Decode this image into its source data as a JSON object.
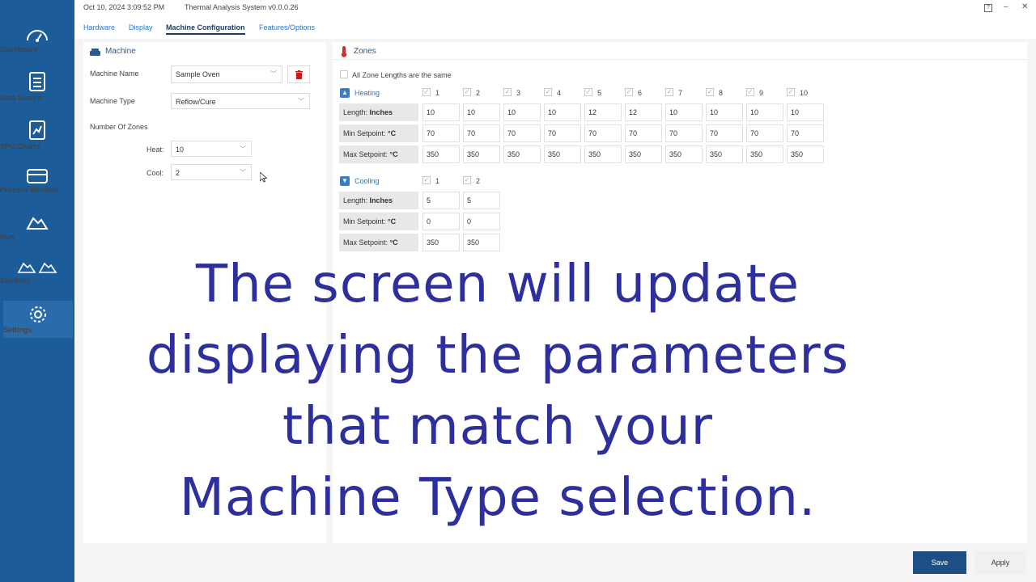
{
  "titlebar": {
    "datetime": "Oct 10, 2024 3:09:52 PM",
    "app_title": "Thermal Analysis System v0.0.0.26",
    "help": "?",
    "minimize": "–",
    "close": "✕"
  },
  "sidebar": {
    "items": [
      {
        "label": "Dashboard",
        "icon": "gauge-icon"
      },
      {
        "label": "Data Search",
        "icon": "document-icon"
      },
      {
        "label": "SPC Charts",
        "icon": "spc-chart-icon"
      },
      {
        "label": "Process Window",
        "icon": "window-icon"
      },
      {
        "label": "Run",
        "icon": "profile-icon"
      },
      {
        "label": "Stacking",
        "icon": "stacking-icon"
      },
      {
        "label": "Settings",
        "icon": "gear-icon"
      }
    ]
  },
  "tabs": [
    {
      "label": "Hardware"
    },
    {
      "label": "Display"
    },
    {
      "label": "Machine Configuration"
    },
    {
      "label": "Features/Options"
    }
  ],
  "machine": {
    "title": "Machine",
    "name_label": "Machine Name",
    "name_value": "Sample Oven",
    "type_label": "Machine Type",
    "type_value": "Reflow/Cure",
    "zones_label": "Number Of Zones",
    "heat_label": "Heat:",
    "heat_value": "10",
    "cool_label": "Cool:",
    "cool_value": "2"
  },
  "zones": {
    "title": "Zones",
    "all_same_label": "All Zone Lengths are the same",
    "heating": {
      "label": "Heating",
      "columns": [
        "1",
        "2",
        "3",
        "4",
        "5",
        "6",
        "7",
        "8",
        "9",
        "10"
      ],
      "length_label": "Length:",
      "length_unit": "Inches",
      "min_label": "Min Setpoint:",
      "max_label": "Max Setpoint:",
      "temp_unit": "°C",
      "length": [
        "10",
        "10",
        "10",
        "10",
        "12",
        "12",
        "10",
        "10",
        "10",
        "10"
      ],
      "min": [
        "70",
        "70",
        "70",
        "70",
        "70",
        "70",
        "70",
        "70",
        "70",
        "70"
      ],
      "max": [
        "350",
        "350",
        "350",
        "350",
        "350",
        "350",
        "350",
        "350",
        "350",
        "350"
      ]
    },
    "cooling": {
      "label": "Cooling",
      "columns": [
        "1",
        "2"
      ],
      "length": [
        "5",
        "5"
      ],
      "min": [
        "0",
        "0"
      ],
      "max": [
        "350",
        "350"
      ]
    }
  },
  "footer": {
    "save": "Save",
    "apply": "Apply"
  },
  "caption": {
    "line1": "The screen will update",
    "line2": "displaying the parameters",
    "line3": "that match your",
    "line4": "Machine Type selection."
  }
}
